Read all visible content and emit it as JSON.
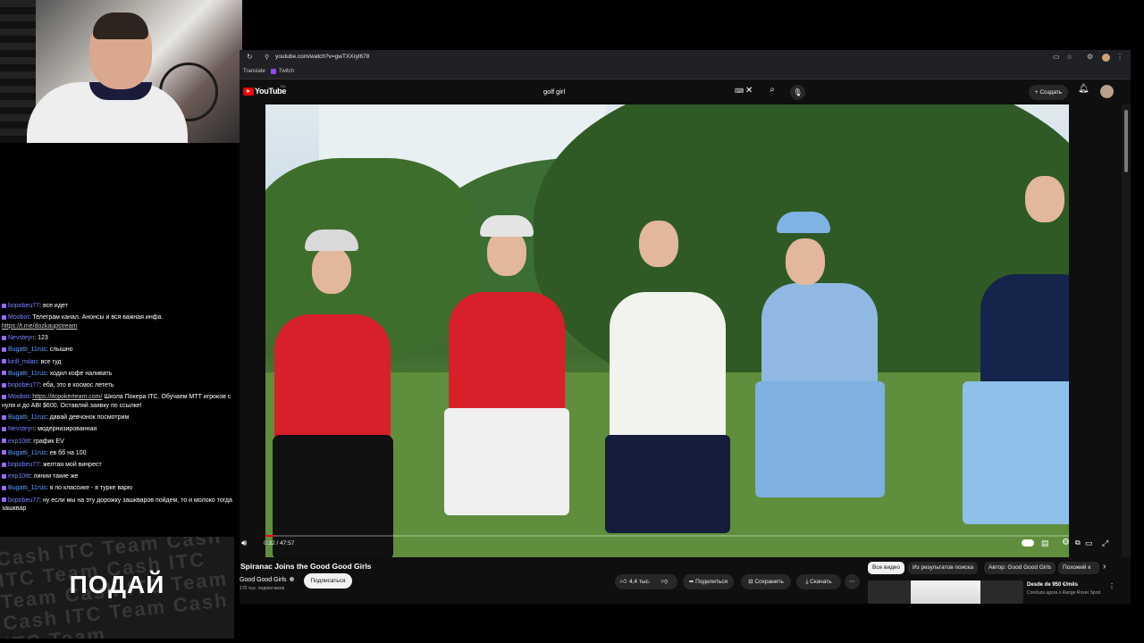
{
  "chat": {
    "messages": [
      {
        "user": "bopobeu77",
        "text": "все идет"
      },
      {
        "user": "Moobot",
        "text": "Телеграм канал. Анонсы и вся важная инфа.",
        "link": "https://t.me/dozkaupstream"
      },
      {
        "user": "Nevsteyn",
        "text": "123"
      },
      {
        "user": "Bugatti_11rus",
        "text": "слышно"
      },
      {
        "user": "kirill_milan",
        "text": "все гуд"
      },
      {
        "user": "Bugatti_11rus",
        "text": "ходил кофе наливать"
      },
      {
        "user": "bopobeu77",
        "text": "еба, это в космос лететь"
      },
      {
        "user": "Moobot",
        "link": "https://itcpokerteam.com/",
        "text": "Школа Покера ITC. Обучаем МТТ игроков с нуля и до ABI $600. Оставляй заявку по ссылке!"
      },
      {
        "user": "Bugatti_11rus",
        "text": "давай девчонок посмотрим"
      },
      {
        "user": "Nevsteyn",
        "text": "модернизированная"
      },
      {
        "user": "exp10itt",
        "text": "график EV"
      },
      {
        "user": "Bugatti_11rus",
        "text": "ев бб на 100"
      },
      {
        "user": "bopobeu77",
        "text": "желтая мой винрест"
      },
      {
        "user": "exp10itt",
        "text": "линии такие же"
      },
      {
        "user": "Bugatti_11rus",
        "text": "я по классике - в турке варю"
      },
      {
        "user": "bopobeu77",
        "text": "ну если мы на эту дорожку зашкваров пойдем, то и молоко тогда зашквар"
      }
    ]
  },
  "banner": {
    "text": "ПОДАЙ",
    "texture": "Cash ITC Team Cash ITC Team Cash ITC Team Cash ITC Team Cash ITC Team Cash ITC Team"
  },
  "browser": {
    "url": "youtube.com/watch?v=gwTXXryl678",
    "bookmarks": [
      "Translate",
      "Twitch"
    ]
  },
  "youtube": {
    "logo": "YouTube",
    "logo_region": "RU",
    "search_value": "golf girl",
    "create_label": "Создать",
    "time": "0:32 / 47:57",
    "progress": 0.011,
    "title": "Spiranac Joins the Good Good Girls",
    "channel": "Good Good Girls",
    "subscribers": "175 тыс. подписчиков",
    "subscribe_label": "Подписаться",
    "likes": "4,4 тыс.",
    "share_label": "Поделиться",
    "save_label": "Сохранить",
    "download_label": "Скачать",
    "chips": [
      "Все видео",
      "Из результатов поиска",
      "Автор: Good Good Girls",
      "Похожий к"
    ],
    "ad": {
      "title": "Desde de 950 €/mês",
      "subtitle": "Conduza agora o Range Rover Sport"
    }
  },
  "colors": {
    "yt_red": "#ff0000",
    "dark_bg": "#0f0f0f",
    "chip_bg": "#272727"
  }
}
